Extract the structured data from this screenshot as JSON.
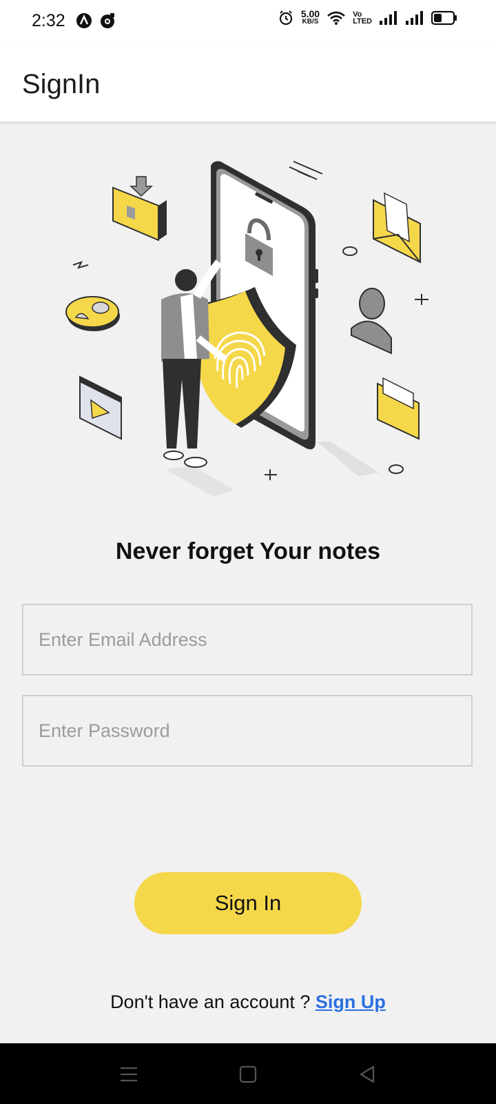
{
  "status_bar": {
    "time": "2:32",
    "speed_value": "5.00",
    "speed_unit": "KB/S",
    "volte_top": "Vo",
    "volte_bottom": "LTED"
  },
  "app_bar": {
    "title": "SignIn"
  },
  "hero": {
    "illustration": "security-fingerprint-illustration"
  },
  "tagline": "Never forget Your notes",
  "form": {
    "email_placeholder": "Enter Email Address",
    "email_value": "",
    "password_placeholder": "Enter Password",
    "password_value": ""
  },
  "signin_button": {
    "label": "Sign In"
  },
  "signup": {
    "prompt": "Don't have an account ? ",
    "link": "Sign Up"
  },
  "colors": {
    "accent": "#f5d74a",
    "link": "#2b6fe0",
    "background": "#f1f1f1"
  },
  "icons": [
    "app-notification-icon",
    "alarm-icon",
    "wifi-icon",
    "signal-icon",
    "battery-icon",
    "menu-icon",
    "home-icon",
    "back-icon"
  ]
}
